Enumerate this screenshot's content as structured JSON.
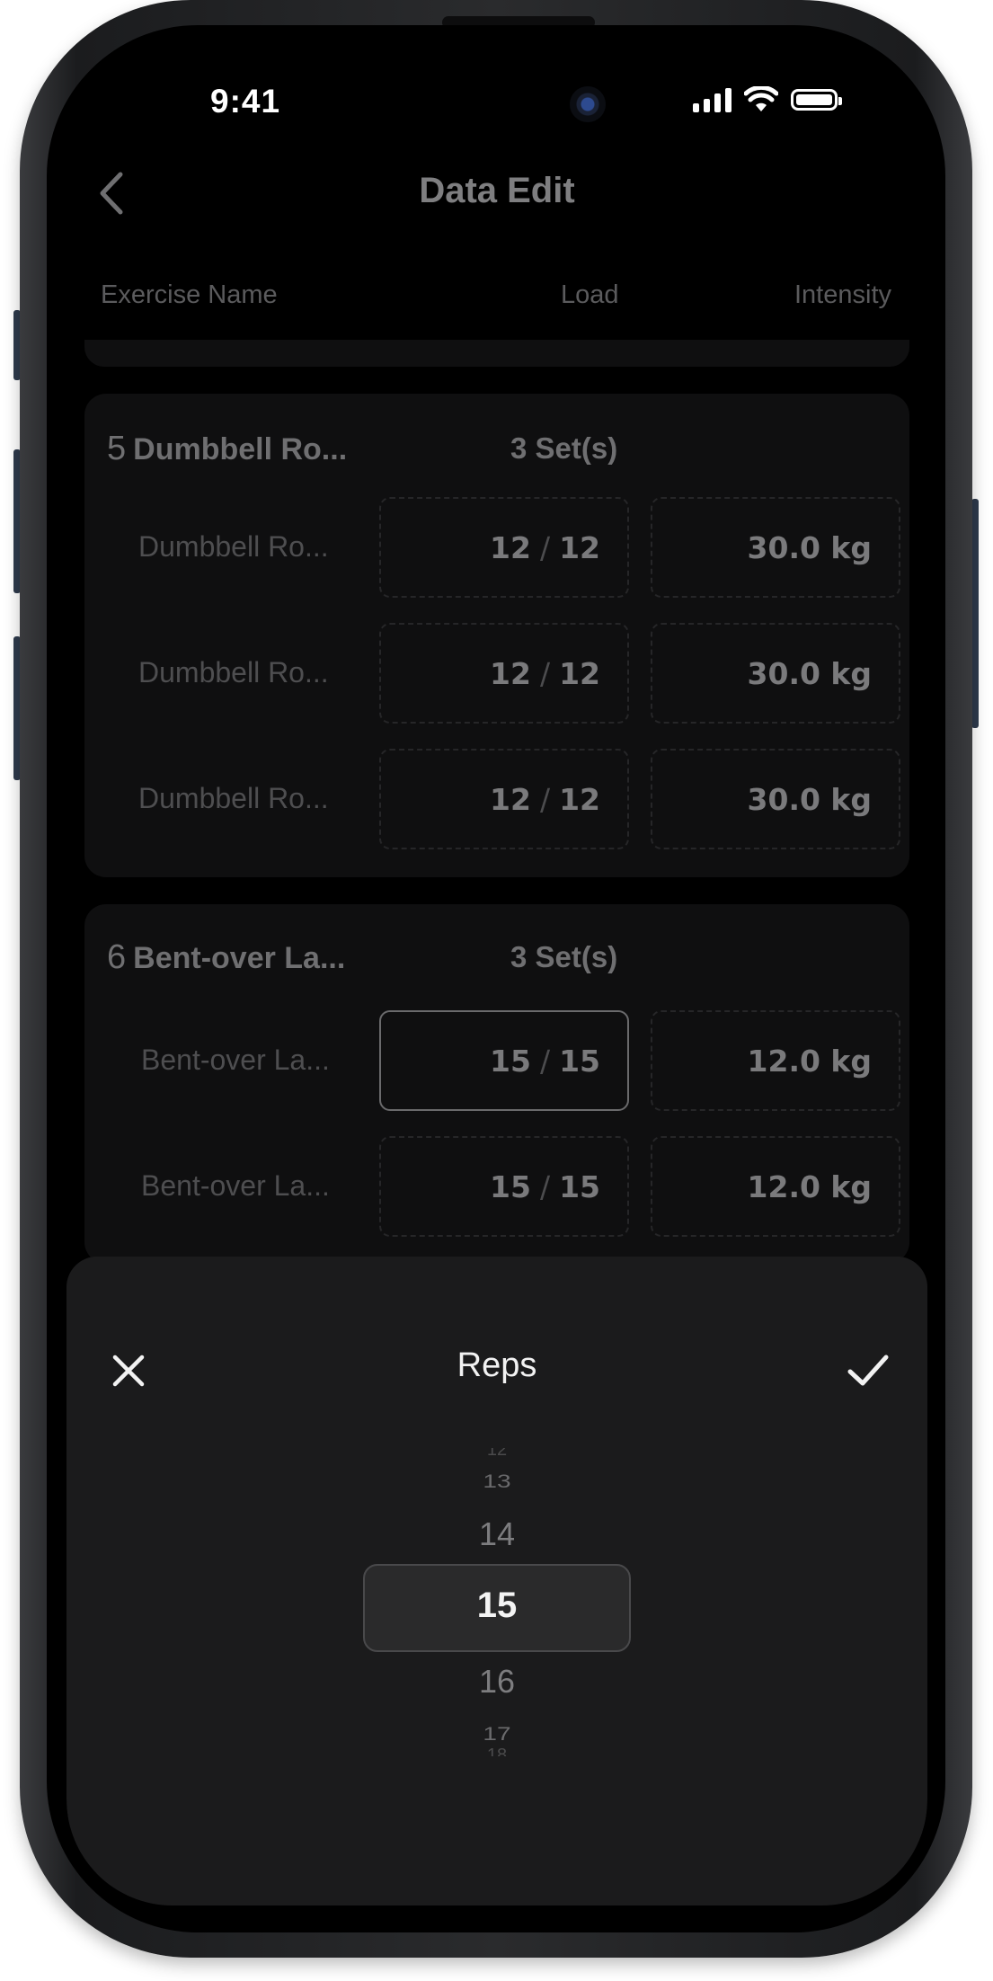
{
  "status_bar": {
    "time": "9:41"
  },
  "header": {
    "title": "Data Edit"
  },
  "columns": {
    "exercise": "Exercise Name",
    "load": "Load",
    "intensity": "Intensity"
  },
  "exercises": [
    {
      "number": "5",
      "name": "Dumbbell Ro...",
      "sets_label": "3 Set(s)",
      "rows": [
        {
          "name": "Dumbbell Ro...",
          "reps": "12",
          "target": "12",
          "weight": "30.0 kg"
        },
        {
          "name": "Dumbbell Ro...",
          "reps": "12",
          "target": "12",
          "weight": "30.0 kg"
        },
        {
          "name": "Dumbbell Ro...",
          "reps": "12",
          "target": "12",
          "weight": "30.0 kg"
        }
      ]
    },
    {
      "number": "6",
      "name": "Bent-over La...",
      "sets_label": "3 Set(s)",
      "rows": [
        {
          "name": "Bent-over La...",
          "reps": "15",
          "target": "15",
          "weight": "12.0 kg"
        },
        {
          "name": "Bent-over La...",
          "reps": "15",
          "target": "15",
          "weight": "12.0 kg"
        }
      ]
    }
  ],
  "sheet": {
    "title": "Reps",
    "selected": "15",
    "options": [
      "12",
      "13",
      "14",
      "15",
      "16",
      "17",
      "18"
    ]
  },
  "icons": {
    "back": "chevron-left-icon",
    "close": "close-icon",
    "confirm": "check-icon"
  },
  "colors": {
    "background": "#000000",
    "card": "#0f0f10",
    "sheet": "#1b1b1c",
    "selected_border": "#6a6a6c"
  }
}
